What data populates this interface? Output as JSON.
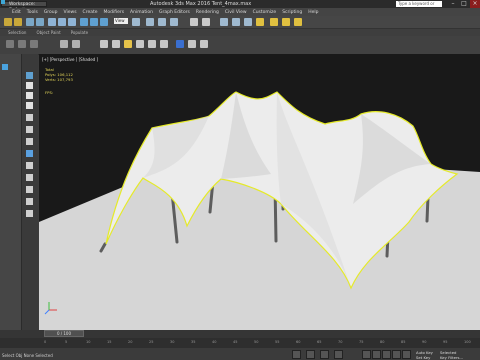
{
  "window": {
    "workspace_label": "Workspace: Default",
    "title": "Autodesk 3ds Max 2016   Tent_4max.max",
    "search_placeholder": "Type a keyword or phrase",
    "min_icon": "minimize-icon",
    "max_icon": "maximize-icon",
    "close_icon": "close-icon"
  },
  "menu": [
    "Edit",
    "Tools",
    "Group",
    "Views",
    "Create",
    "Modifiers",
    "Animation",
    "Graph Editors",
    "Rendering",
    "Civil View",
    "Customize",
    "Scripting",
    "Help"
  ],
  "toolbar": {
    "view_select": "View"
  },
  "ribbon_tabs": [
    "Selection",
    "Object Paint",
    "Populate"
  ],
  "viewport": {
    "label": "[+] [Perspective ] [Shaded ]",
    "stats_title": "Total",
    "polys_label": "Polys:",
    "polys_value": "106,112",
    "verts_label": "Verts:",
    "verts_value": "107,793",
    "fps_label": "FPS:"
  },
  "timeline": {
    "slider_label": "0 / 100",
    "ticks": [
      "0",
      "5",
      "10",
      "15",
      "20",
      "25",
      "30",
      "35",
      "40",
      "45",
      "50",
      "55",
      "60",
      "65",
      "70",
      "75",
      "80",
      "85",
      "90",
      "95",
      "100"
    ]
  },
  "status": {
    "text": "Select Obj  None Selected",
    "auto_key": "Auto Key",
    "selected": "Selected",
    "set_key": "Set Key",
    "key_filters": "Key Filters..."
  },
  "colors": {
    "viewport_bg": "#191919",
    "ground": "#d8d8d8",
    "tent": "#e9e9e9",
    "selection_outline": "#e6ea2a",
    "stats_text": "#e6d85a"
  }
}
